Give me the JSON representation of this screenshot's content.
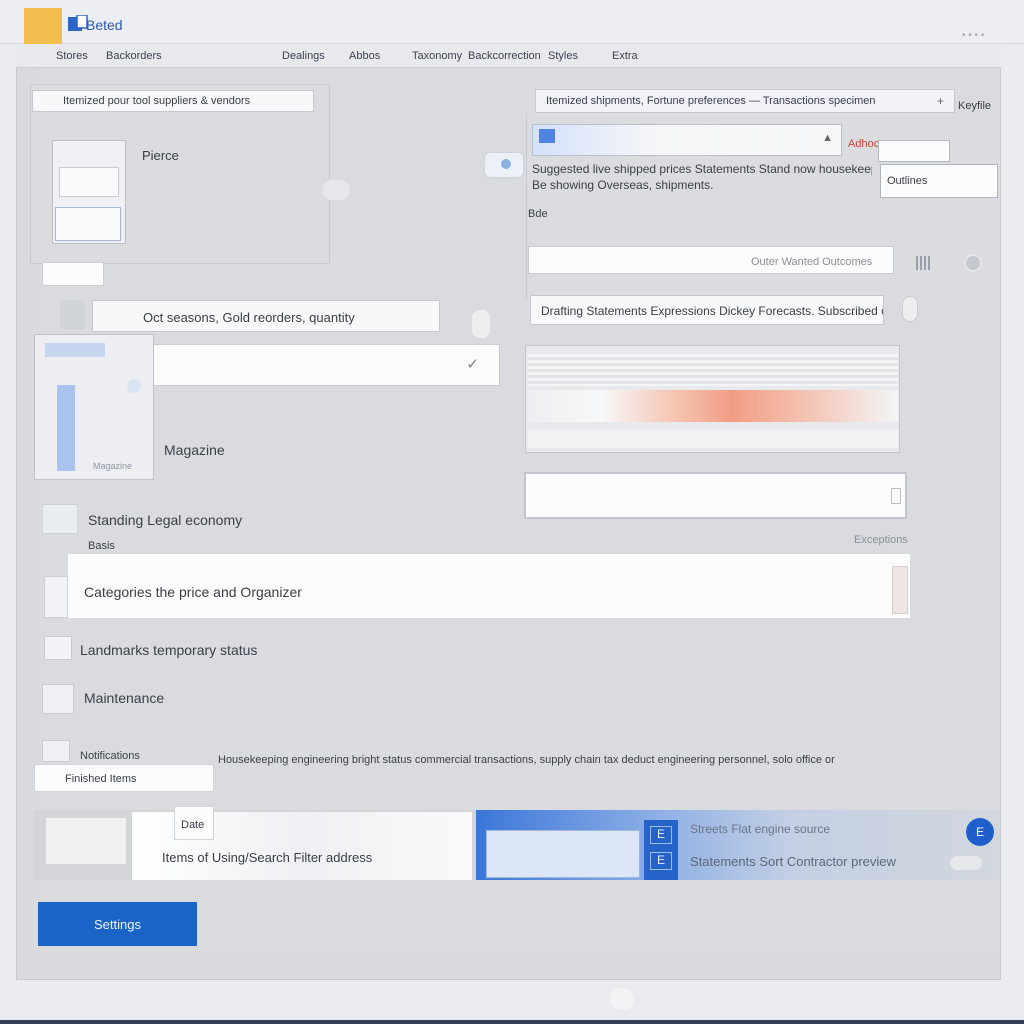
{
  "app": {
    "title": "Beted"
  },
  "menu": [
    "Stores",
    "Backorders",
    "Dealings",
    "Abbos",
    "Taxonomy",
    "Backcorrection",
    "Styles",
    "Extra"
  ],
  "left": {
    "search_value": "Itemized pour tool suppliers & vendors",
    "card_title": "Pierce",
    "input_placeholder": "Oct seasons, Gold reorders, quantity",
    "select_value": "",
    "stack_label": "Magazine",
    "preview_caption": "Magazine"
  },
  "right": {
    "address_value": "Itemized shipments, Fortune preferences — Transactions specimen",
    "side_label": "Keyfile",
    "quote_text": "Suggested live shipped prices Statements Stand now housekeeping",
    "quote_text_2": "Be showing Overseas, shipments.",
    "badge_label": "Adhoc",
    "small_label": "Bde",
    "outline_button": "Outlines",
    "dropdown_text": "Outer Wanted Outcomes",
    "info_input": "Drafting Statements Expressions Dickey Forecasts. Subscribed ones",
    "grid_icon": "grid-icon",
    "circle_icon": "circle-icon"
  },
  "list": {
    "section_heading": "Standing Legal economy",
    "section_sub": "Basis",
    "right_meta": "Exceptions",
    "banner_text": "Categories the price and Organizer",
    "row1": "Landmarks temporary status",
    "row2": "Maintenance",
    "row3_label": "Notifications",
    "row3_detail": "Housekeeping engineering bright status commercial transactions, supply chain tax deduct engineering personnel, solo office or",
    "chip": "Finished Items"
  },
  "strip": {
    "left_tag": "Date",
    "left_text": "Items of Using/Search Filter address",
    "right_line1": "Streets  Flat engine source",
    "right_line2": "Statements  Sort  Contractor preview",
    "badge1": "E",
    "badge2": "E",
    "circle": "E"
  },
  "actions": {
    "primary": "Settings"
  },
  "colors": {
    "accent": "#1a64c8",
    "brand": "#f2be4e",
    "highlight": "#f19d85"
  }
}
